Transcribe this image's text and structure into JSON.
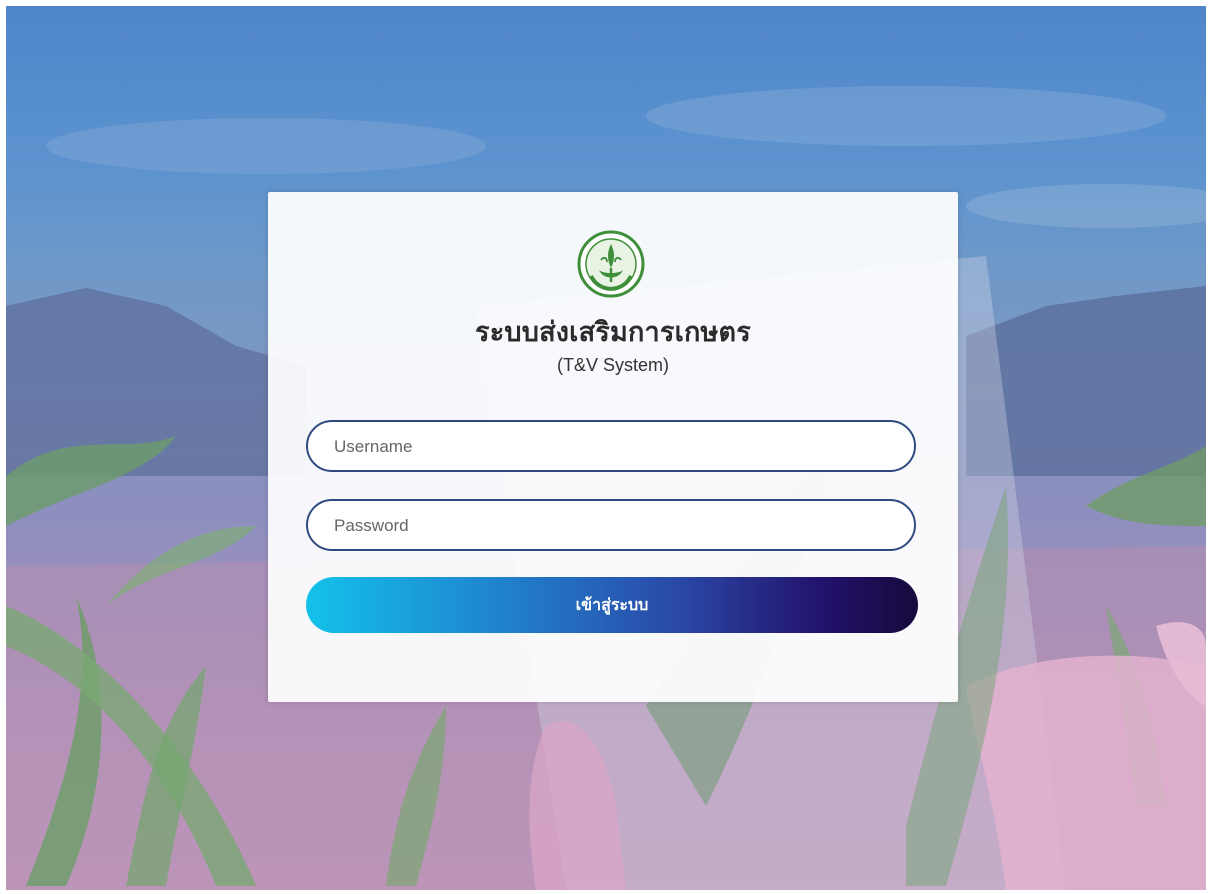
{
  "login": {
    "title": "ระบบส่งเสริมการเกษตร",
    "subtitle": "(T&V System)",
    "username_placeholder": "Username",
    "username_value": "",
    "password_placeholder": "Password",
    "password_value": "",
    "submit_label": "เข้าสู่ระบบ"
  },
  "icons": {
    "logo": "agriculture-department-seal-icon"
  },
  "colors": {
    "field_border": "#2f4a80",
    "button_gradient_start": "#13c2ea",
    "button_gradient_end": "#160a3c",
    "logo_green": "#3f8f3a"
  }
}
